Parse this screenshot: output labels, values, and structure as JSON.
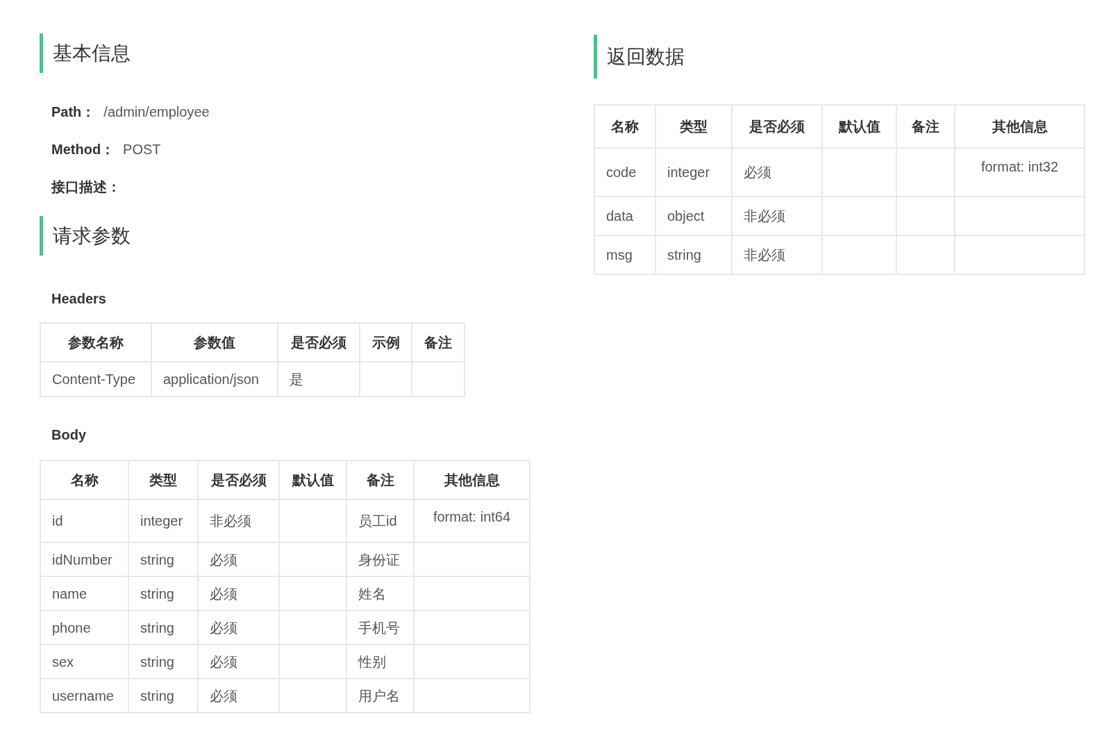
{
  "basic_info": {
    "title": "基本信息",
    "fields": [
      {
        "label": "Path：",
        "value": "/admin/employee"
      },
      {
        "label": "Method：",
        "value": "POST"
      },
      {
        "label": "接口描述："
      }
    ]
  },
  "request_params": {
    "title": "请求参数",
    "headers": {
      "label": "Headers",
      "columns": [
        "参数名称",
        "参数值",
        "是否必须",
        "示例",
        "备注"
      ],
      "rows": [
        {
          "name": "Content-Type",
          "value": "application/json",
          "required": "是"
        }
      ]
    },
    "body": {
      "label": "Body",
      "columns": [
        "名称",
        "类型",
        "是否必须",
        "默认值",
        "备注",
        "其他信息"
      ],
      "rows": [
        {
          "name": "id",
          "type": "integer",
          "required": "非必须",
          "note": "员工id",
          "other": "format: int64"
        },
        {
          "name": "idNumber",
          "type": "string",
          "required": "必须",
          "note": "身份证"
        },
        {
          "name": "name",
          "type": "string",
          "required": "必须",
          "note": "姓名"
        },
        {
          "name": "phone",
          "type": "string",
          "required": "必须",
          "note": "手机号"
        },
        {
          "name": "sex",
          "type": "string",
          "required": "必须",
          "note": "性别"
        },
        {
          "name": "username",
          "type": "string",
          "required": "必须",
          "note": "用户名"
        }
      ]
    }
  },
  "response_data": {
    "title": "返回数据",
    "columns": [
      "名称",
      "类型",
      "是否必须",
      "默认值",
      "备注",
      "其他信息"
    ],
    "rows": [
      {
        "name": "code",
        "type": "integer",
        "required": "必须",
        "other": "format: int32"
      },
      {
        "name": "data",
        "type": "object",
        "required": "非必须"
      },
      {
        "name": "msg",
        "type": "string",
        "required": "非必须"
      }
    ]
  }
}
